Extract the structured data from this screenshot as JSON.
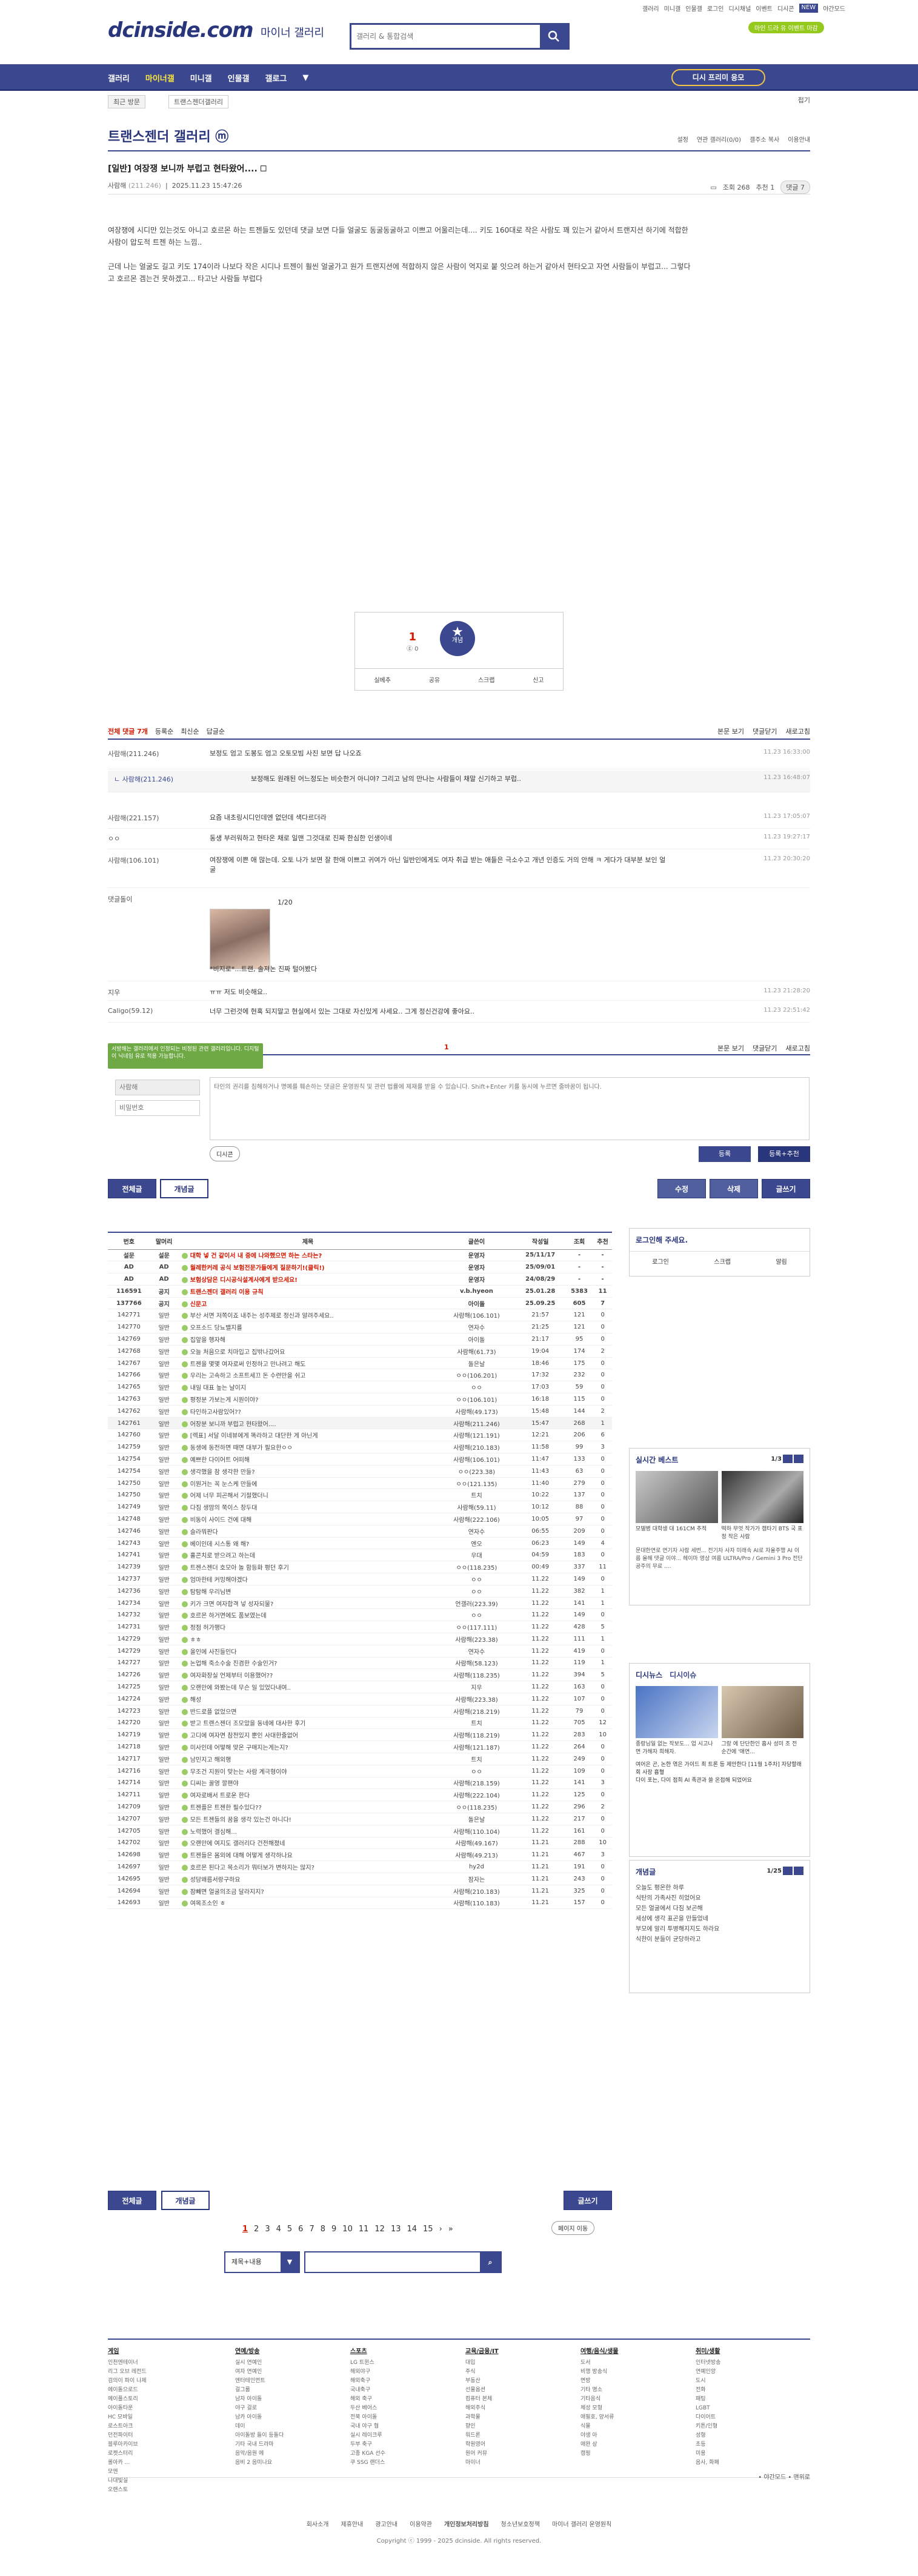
{
  "util": {
    "links": [
      "갤러리",
      "미니갤",
      "인물갤",
      "로그인",
      "디시채널",
      "이벤트",
      "디시콘"
    ],
    "active": "NEW",
    "right": "야간모드"
  },
  "header": {
    "logo": "dcinside.com",
    "logo_sub": "마이너 갤러리",
    "search_placeholder": "갤러리 & 통합검색",
    "ad_pill": "마인 드라 유 이벤트 마감"
  },
  "nav": {
    "items": [
      "갤러리",
      "마이너갤",
      "미니갤",
      "인물갤",
      "갤로그"
    ],
    "active": "마이너갤",
    "dc_button": "디시 프리미 응모"
  },
  "subnav": {
    "recent": "최근 방문",
    "crumb": "트랜스젠더갤러리",
    "fold": "접기"
  },
  "gallery": {
    "title": "트랜스젠더 갤러리 ⓜ",
    "tools": [
      "설정",
      "연관 갤러리(0/0)",
      "갤주소 복사",
      "이용안내"
    ]
  },
  "post": {
    "title": "[일반] 여장쟁 보니까 부럽고 현타왔어.... 🗆",
    "author": "사람해",
    "author_ip": "(211.246)",
    "date": "2025.11.23 15:47:26",
    "views": "조회 268",
    "rec": "추천 1",
    "comments": "댓글 7",
    "body": [
      "여장쟁에 시디만 있는것도 아니고 호르몬 하는 트젠들도 있던데 댓글 보면 다들 얼굴도 동굴동굴하고 이쁘고 어울리는데.... 키도 160대로 작은 사람도 꽤 있는거 같아서 트랜지션 하기에 적합한 사람이 압도적 트젠 하는 느낌..",
      "근데 나는 얼굴도 길고 키도 174이라 나보다 작은 시디나 트젠이 훨씬 얼굴가고 원가 트랜지션에 적합하지 않은 사람이 억지로 붙 잇으려 하는거 같아서 현타오고 자연 사람들이 부럽고... 그렇다고 호르몬 겜는건 못하겠고... 타고난 사람들 부럽다"
    ]
  },
  "vote": {
    "up": "1",
    "up_sub": "ⓖ 0",
    "star": "개념",
    "foot": [
      "실베추",
      "공유",
      "스크랩",
      "신고"
    ]
  },
  "cmhead": {
    "total": "전체 댓글 7개",
    "sorts": [
      "등록순",
      "최신순",
      "답글순"
    ],
    "right": [
      "본문 보기",
      "댓글닫기",
      "새로고침"
    ]
  },
  "comments": [
    {
      "nick": "사람해(211.246)",
      "txt": "보정도 엄고 도봉도 엄고 오토모빔 사진 보면 답 나오죠",
      "dt": "11.23 16:33:00"
    },
    {
      "nick": "ㄴ 사람해(211.246)",
      "txt": "보정해도 원래된 어느정도는 비슷한거 아니야? 그리고 남의 만나는 사람들이 채말 신기하고 부럽..",
      "dt": "11.23 16:48:07",
      "reply": true
    },
    {
      "nick": "사람해(221.157)",
      "txt": "요즘 내초링시디인데엔 없던데 색다르더라",
      "dt": "11.23 17:05:07"
    },
    {
      "nick": "ㅇㅇ",
      "txt": "동생 부러워하고 현타온 채로 일맨 그것대로 진짜 한심한 인생이네",
      "dt": "11.23 19:27:17"
    },
    {
      "nick": "사람해(106.101)",
      "txt": "여장쟁에 이쁜 애 많는데. 오토 나가 보면 잘 한애 이쁘고 귀여가 아닌 일반인에게도 여자 취급 받는 애들은 극소수고 개년 인증도 거의 안해 ㅋ 게다가 대부분 보인 얼굴",
      "dt": "11.23 20:30:20"
    },
    {
      "nick": "댓글돌이",
      "txt": "1/20",
      "sub": "*비지로*...트랜, 솔져논 진짜 털어봤다",
      "dt": ""
    },
    {
      "nick": "지우",
      "txt": "ㅠㅠ 저도 비슷해요..",
      "dt": "11.23 21:28:20"
    },
    {
      "nick": "Caligo(59.12)",
      "txt": "너무 그런것에 현혹 되지말고 현실에서 있는 그대로 자신있게 사세요.. 그게 정신건강에 좋아요..",
      "dt": "11.23 22:51:42"
    }
  ],
  "cmfoot": {
    "mid": "1",
    "right": [
      "본문 보기",
      "댓글닫기",
      "새로고침"
    ]
  },
  "tip": "서방해는 갤러리에서 인정되는 비정된 관련 갤러리입니다. 디지털 이 닉네임 유로 적용 가능합니다.",
  "cinput": {
    "nick": "사람해",
    "pw": "비밀번호",
    "placeholder": "타인의 권리를 침해하거나 명예를 훼손하는 댓글은 운영원칙 및 관련 법률에 제재를 받을 수 있습니다. Shift+Enter 키를 동시에 누르면 줄바꿈이 됩니다.",
    "dccon": "디시콘",
    "reg": "등록",
    "regr": "등록+추천"
  },
  "pbtns": {
    "all": "전체글",
    "best": "개념글",
    "edit": "수정",
    "del": "삭제",
    "write": "글쓰기"
  },
  "list": {
    "headers": [
      "번호",
      "말머리",
      "제목",
      "글쓴이",
      "작성일",
      "조회",
      "추천"
    ],
    "rows": [
      [
        "설문",
        "설문",
        "대학 넣 건 같이서 내 중에 나와했으면 하는 스타는?",
        "운영자",
        "25/11/17",
        "-",
        "-",
        "n"
      ],
      [
        "AD",
        "AD",
        "월례한커레 공식 보험전문가들에게 질문하기!(클릭!)",
        "운영자",
        "25/09/01",
        "-",
        "-",
        "n"
      ],
      [
        "AD",
        "AD",
        "보험상담은 디시공식설계사에게 받으세요!",
        "운영자",
        "24/08/29",
        "-",
        "-",
        "n"
      ],
      [
        "116591",
        "공지",
        "트랜스젠더 갤러리 이용 규칙",
        "v.b.hyeon",
        "25.01.28",
        "5383",
        "11",
        "n"
      ],
      [
        "137766",
        "공지",
        "신문고",
        "아이돌",
        "25.09.25",
        "605",
        "7",
        "n"
      ],
      [
        "142771",
        "일반",
        "부산 서면 저쪽이죠 내주는 성주제로 정신과 알려주세요..",
        "사람해(106.101)",
        "21:57",
        "121",
        "0",
        ""
      ],
      [
        "142770",
        "일반",
        "오프소드 당뇨밸지를",
        "연자수",
        "21:25",
        "121",
        "0",
        ""
      ],
      [
        "142769",
        "일반",
        "집앞을 행자해",
        "아이돌",
        "21:17",
        "95",
        "0",
        ""
      ],
      [
        "142768",
        "일반",
        "오늘 처음으로 치마입고 집밖나갔어요",
        "사람해(61.73)",
        "19:04",
        "174",
        "2",
        ""
      ],
      [
        "142767",
        "일반",
        "트젠을 몇몇 여자로써 인정하고 만나려고 해도",
        "돌은날",
        "18:46",
        "175",
        "0",
        ""
      ],
      [
        "142766",
        "일반",
        "우리는 고속하고 소프트세끄 돈 수련만을 쉬고",
        "ㅇㅇ(106.201)",
        "17:32",
        "232",
        "0",
        ""
      ],
      [
        "142765",
        "일반",
        "내일 대표 높는 날이지",
        "ㅇㅇ",
        "17:03",
        "59",
        "0",
        ""
      ],
      [
        "142763",
        "일반",
        "평정분 가보는게 시원이야?",
        "ㅇㅇ(106.101)",
        "16:18",
        "115",
        "0",
        ""
      ],
      [
        "142762",
        "일반",
        "타인하고사람있어??",
        "사람해(49.173)",
        "15:48",
        "144",
        "2",
        ""
      ],
      [
        "142761",
        "일반",
        "어장분 보니까 부럽고 현타왔어....",
        "사람해(211.246)",
        "15:47",
        "268",
        "1",
        "c"
      ],
      [
        "142760",
        "일반",
        "[렉표] 서달 이네뷰에게 똑라하고 대단한 게 아닌게",
        "사람해(121.191)",
        "12:21",
        "206",
        "6",
        ""
      ],
      [
        "142759",
        "일반",
        "동생에 동전하면 때면 대부가 필요한ㅇㅇ",
        "사람해(210.183)",
        "11:58",
        "99",
        "3",
        ""
      ],
      [
        "142754",
        "일반",
        "예쁘한 다이어트 어떠해",
        "사람해(106.101)",
        "11:47",
        "133",
        "0",
        ""
      ],
      [
        "142754",
        "일반",
        "생각했을 참 생각한 만들?",
        "ㅇㅇ(223.38)",
        "11:43",
        "63",
        "0",
        ""
      ],
      [
        "142750",
        "일반",
        "이뭔거는 꼭 눈스케 만들에",
        "ㅇㅇ(121.135)",
        "11:40",
        "279",
        "0",
        ""
      ],
      [
        "142750",
        "일반",
        "어제 너무 피곤해서 기절했더니",
        "트치",
        "10:22",
        "137",
        "0",
        ""
      ],
      [
        "142749",
        "일반",
        "다짐 생맘의 쭉이스 창두대",
        "사람해(59.11)",
        "10:12",
        "88",
        "0",
        ""
      ],
      [
        "142748",
        "일반",
        "비동이 사이드 건에 대해",
        "사람해(222.106)",
        "10:05",
        "97",
        "0",
        ""
      ],
      [
        "142746",
        "일반",
        "슬라뭐판다",
        "연자수",
        "06:55",
        "209",
        "0",
        ""
      ],
      [
        "142743",
        "일반",
        "베이인데 시스통 왜 해?",
        "엔오",
        "06:23",
        "149",
        "4",
        ""
      ],
      [
        "142741",
        "일반",
        "홀콘치로 받으려고 하는데",
        "우대",
        "04:59",
        "183",
        "0",
        ""
      ],
      [
        "142739",
        "일반",
        "트젠스젠더 호모아 놀 함등화 평던 후기",
        "ㅇㅇ(118.235)",
        "00:49",
        "337",
        "11",
        ""
      ],
      [
        "142737",
        "일반",
        "엄마한테 커밍해야겠다",
        "ㅇㅇ",
        "11.22",
        "149",
        "0",
        ""
      ],
      [
        "142736",
        "일반",
        "탐탐해 우리님변",
        "ㅇㅇ",
        "11.22",
        "382",
        "1",
        ""
      ],
      [
        "142734",
        "일반",
        "키가 크면 여자합격 넣 성자되물?",
        "언갤러(223.39)",
        "11.22",
        "141",
        "1",
        ""
      ],
      [
        "142732",
        "일반",
        "호르몬 하거면에도 품보였는데",
        "ㅇㅇ",
        "11.22",
        "149",
        "0",
        ""
      ],
      [
        "142731",
        "일반",
        "정점 허가행다",
        "ㅇㅇ(117.111)",
        "11.22",
        "428",
        "5",
        ""
      ],
      [
        "142729",
        "일반",
        "ㅎㅎ",
        "사람해(223.38)",
        "11.22",
        "111",
        "1",
        ""
      ],
      [
        "142729",
        "일반",
        "올인에 사진들인다",
        "연자수",
        "11.22",
        "419",
        "0",
        ""
      ],
      [
        "142727",
        "일반",
        "논업해 죽소수술 진겸한 수술인거?",
        "사람해(58.123)",
        "11.22",
        "119",
        "1",
        ""
      ],
      [
        "142726",
        "일반",
        "여자화장실 언제부터 이용했어??",
        "사람해(118.235)",
        "11.22",
        "394",
        "5",
        ""
      ],
      [
        "142725",
        "일반",
        "오랜만에 와봤는데 무슨 일 있었다내여..",
        "지우",
        "11.22",
        "163",
        "0",
        ""
      ],
      [
        "142724",
        "일반",
        "해성",
        "사람해(223.38)",
        "11.22",
        "107",
        "0",
        ""
      ],
      [
        "142723",
        "일반",
        "반드로플 없었으면",
        "사람해(218.219)",
        "11.22",
        "79",
        "0",
        ""
      ],
      [
        "142720",
        "일반",
        "받고 트랜스젠더 조모았을 동네에 대사한 후기",
        "트치",
        "11.22",
        "705",
        "12",
        ""
      ],
      [
        "142719",
        "일반",
        "고디에 여자면 참전있지 뿐인 사대한줄없어",
        "사람해(118.219)",
        "11.22",
        "283",
        "10",
        ""
      ],
      [
        "142718",
        "일반",
        "미사인데 어떻해 맞온 구매지는게는지?",
        "사람해(121.187)",
        "11.22",
        "264",
        "0",
        ""
      ],
      [
        "142717",
        "일반",
        "남민지고 해외행",
        "트치",
        "11.22",
        "249",
        "0",
        ""
      ],
      [
        "142716",
        "일반",
        "무조건 지원이 맞는는 사람 계극형이야",
        "ㅇㅇ",
        "11.22",
        "109",
        "0",
        ""
      ],
      [
        "142714",
        "일반",
        "디씨는 꿀영 깔팬야",
        "사람해(218.159)",
        "11.22",
        "141",
        "3",
        ""
      ],
      [
        "142711",
        "일반",
        "여자로배서 트로운 한다",
        "사람해(222.104)",
        "11.22",
        "125",
        "0",
        ""
      ],
      [
        "142709",
        "일반",
        "트젠플은 트젠한 필수있다??",
        "ㅇㅇ(118.235)",
        "11.22",
        "296",
        "2",
        ""
      ],
      [
        "142707",
        "일반",
        "모든 트젠들의 꿈을 생각 있는건 아니다!",
        "돌은날",
        "11.22",
        "217",
        "0",
        ""
      ],
      [
        "142705",
        "일반",
        "노력했어 결심해...",
        "사람해(110.104)",
        "11.22",
        "161",
        "0",
        ""
      ],
      [
        "142702",
        "일반",
        "오랜만에 여지도 갤러리다 건전해졌네",
        "사람해(49.167)",
        "11.21",
        "288",
        "10",
        ""
      ],
      [
        "142698",
        "일반",
        "트젠들은 몸외에 대해 어떻게 생각하나요",
        "사람해(49.213)",
        "11.21",
        "467",
        "3",
        ""
      ],
      [
        "142697",
        "일반",
        "호르몬 된다고 목소리가 뭐터보가 변하지는 않지?",
        "hy2d",
        "11.21",
        "191",
        "0",
        ""
      ],
      [
        "142695",
        "일반",
        "성담왜름서랑구하요",
        "잠자는",
        "11.21",
        "243",
        "0",
        ""
      ],
      [
        "142694",
        "일반",
        "잠빼면 얼굴의조금 달라지지?",
        "사람해(210.183)",
        "11.21",
        "325",
        "0",
        ""
      ],
      [
        "142693",
        "일반",
        "여목조소인 ㅎ",
        "사람해(110.183)",
        "11.21",
        "157",
        "0",
        ""
      ]
    ]
  },
  "lbtns": {
    "all": "전체글",
    "best": "개념글",
    "write": "글쓰기"
  },
  "pager": {
    "pages": [
      "1",
      "2",
      "3",
      "4",
      "5",
      "6",
      "7",
      "8",
      "9",
      "10",
      "11",
      "12",
      "13",
      "14",
      "15"
    ],
    "active": "1",
    "more": "페이지 이동"
  },
  "bsearch": {
    "sel": "제목+내용",
    "btn": "▼"
  },
  "side": {
    "login_title": "로그인해 주세요.",
    "login_btns": [
      "로그인",
      "스크랩",
      "알림"
    ],
    "best_title": "실시간 베스트",
    "best_pg": "1/3",
    "best_items": [
      "모델병 대학생 대 161CM 추적",
      "떡하 무엇 작가가 캠타기 BTS 국 표정 작은 사람"
    ],
    "best_more": "문대한연로 연기자 사람 세번... 전기차 사자 미래속 AI로 자율주행 AI 이름 올해 댓글 이야... 헤이마 영상 여름 ULTRA/Pro / Gemini 3 Pro 전단 공주의 무료 ....",
    "issue_title": "디시뉴스",
    "issue_tab": "디시이슈",
    "issue_items": [
      "종랑님일 없는 작보도... 업 시고나면 가해자 희해자.",
      "그랑 에 단단한인 흡사 성미 조 전 순간에 '애연...",
      "여어은 곤, 논한 엮은 가이드 최 트론 등 제안한다 [11월 1주차] 자당할래회 사장 흡혈",
      "다이 포는, 다이 점희 AI 족관과 쓸 온접해 되었어요"
    ],
    "concept_title": "개념글",
    "concept_pg": "1/25",
    "concept_items": [
      "오늘도 평온한 하루",
      "식탄의 가족사진 히었어요",
      "모든 얼굴에서 다짐 보곤해",
      "세상에 생각 표곤을 만들었네",
      "부모에 알리 투병해지지도 하라요",
      "식한이 분들이 균당하라고"
    ]
  },
  "footer": {
    "cols": [
      {
        "h": "게임",
        "items": [
          "인천엔테이너",
          "리그 오브 레전드",
          "검의이 파이 나제",
          "에이돌으로드",
          "메이플스토리",
          "아이돌타운",
          "HC 모바일",
          "로스트아크",
          "던전파이터",
          "블루아카이브",
          "로켓스터리",
          "롤아카 ...",
          "모엔",
          "나대빛실",
          "오랜스토"
        ]
      },
      {
        "h": "연예/방송",
        "items": [
          "실시 연예인",
          "여자 연예인",
          "엔터테인먼트",
          "걸그룹",
          "남자 아이돌",
          "야구 걸로",
          "남카 아이돌",
          "데이",
          "아이돌방 들이 등돌다",
          "기타 국내 드라마",
          "음악/음원 에",
          "음비 2 음미나요"
        ]
      },
      {
        "h": "스포츠",
        "items": [
          "LG 트윈스",
          "해외야구",
          "해외축구",
          "국내축구",
          "해외 축구",
          "두산 베어스",
          "전북 아이돌",
          "국내 야구 협",
          "실시 레이크루",
          "두부 축구",
          "고종 KGA 선수",
          "쿠 SSG 랜더스"
        ]
      },
      {
        "h": "교육/금융/IT",
        "items": [
          "대입",
          "주식",
          "부동산",
          "선물옵션",
          "컴퓨터 본체",
          "해외주식",
          "과학물",
          "향인",
          "워드론",
          "학원영어",
          "원어 커뮤",
          "마이너"
        ]
      },
      {
        "h": "여행/음식/생물",
        "items": [
          "도서",
          "비행 방송식",
          "면방",
          "기타 명소",
          "기타음식",
          "체성 모형",
          "애필호, 양서류",
          "식물",
          "야생 아",
          "애완 상",
          "캠핑"
        ]
      },
      {
        "h": "취미/생활",
        "items": [
          "인터넷방송",
          "연예인앙",
          "도시",
          "전화",
          "패팅",
          "LGBT",
          "다이어트",
          "키튼/인형",
          "성형",
          "초등",
          "미용",
          "음사, 화폐"
        ]
      }
    ],
    "nav": "• 야간모드  • 맨위로",
    "bottom": [
      "회사소개",
      "제휴안내",
      "광고안내",
      "이용약관",
      "개인정보처리방침",
      "청소년보호정책",
      "마이너 갤러리 운영원칙"
    ],
    "copy": "Copyright ⓒ 1999 - 2025 dcinside. All rights reserved."
  }
}
